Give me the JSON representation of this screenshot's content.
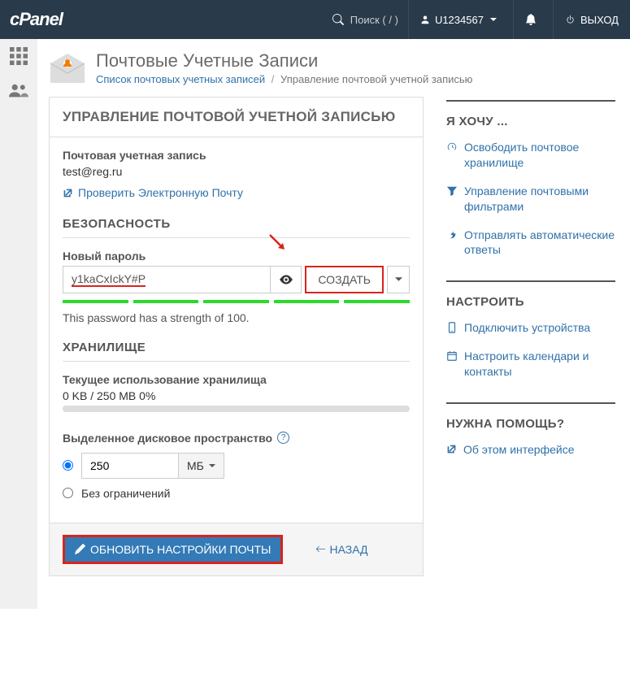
{
  "top": {
    "search_placeholder": "Поиск ( / )",
    "user": "U1234567",
    "logout": "ВЫХОД"
  },
  "page": {
    "title": "Почтовые Учетные Записи",
    "breadcrumb_list": "Список почтовых учетных записей",
    "breadcrumb_current": "Управление почтовой учетной записью"
  },
  "panel": {
    "heading": "УПРАВЛЕНИЕ ПОЧТОВОЙ УЧЕТНОЙ ЗАПИСЬЮ",
    "account_label": "Почтовая учетная запись",
    "account_value": "test@reg.ru",
    "check_mail": "Проверить Электронную Почту"
  },
  "security": {
    "heading": "БЕЗОПАСНОСТЬ",
    "new_password_label": "Новый пароль",
    "password_value": "y1kaCxIckY#P",
    "generate": "СОЗДАТЬ",
    "strength_text": "This password has a strength of 100."
  },
  "storage": {
    "heading": "ХРАНИЛИЩЕ",
    "usage_label": "Текущее использование хранилища",
    "usage_value": "0 KB / 250 MB 0%",
    "quota_label": "Выделенное дисковое пространство",
    "quota_value": "250",
    "quota_unit": "МБ",
    "unlimited": "Без ограничений"
  },
  "footer": {
    "update": "ОБНОВИТЬ НАСТРОЙКИ ПОЧТЫ",
    "back": "НАЗАД"
  },
  "side": {
    "want_heading": "Я ХОЧУ ...",
    "want_links": [
      "Освободить почтовое хранилище",
      "Управление почтовыми фильтрами",
      "Отправлять автоматические ответы"
    ],
    "configure_heading": "НАСТРОИТЬ",
    "configure_links": [
      "Подключить устройства",
      "Настроить календари и контакты"
    ],
    "help_heading": "НУЖНА ПОМОЩЬ?",
    "help_link": "Об этом интерфейсе"
  }
}
